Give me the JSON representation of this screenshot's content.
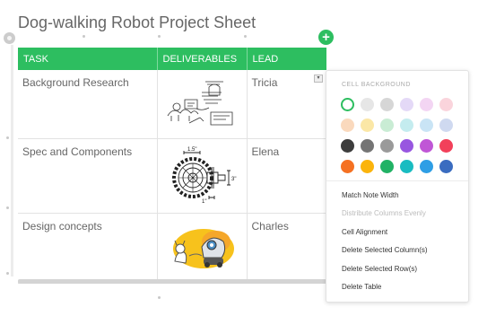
{
  "note": {
    "title": "Dog-walking Robot Project Sheet"
  },
  "table": {
    "columns": [
      "TASK",
      "DELIVERABLES",
      "LEAD"
    ],
    "rows": [
      {
        "task": "Background Research",
        "deliverable_icon": "robot-sketch-icon",
        "lead": "Tricia"
      },
      {
        "task": "Spec and Components",
        "deliverable_icon": "gear-diagram-icon",
        "lead": "Elena"
      },
      {
        "task": "Design concepts",
        "deliverable_icon": "robot-concept-icon",
        "lead": "Charles"
      }
    ],
    "header_color": "#2dbe60"
  },
  "diagram_labels": {
    "dim_top": "1.5\"",
    "dim_right": "3\"",
    "dim_bottom": "1\""
  },
  "popover": {
    "section_label": "CELL BACKGROUND",
    "swatch_colors": [
      "#ffffff",
      "#e6e6e6",
      "#d6d6d6",
      "#e4d9f7",
      "#f3d5f3",
      "#fad4dc",
      "#fad9bd",
      "#fbe7a6",
      "#c9ecd4",
      "#c4ecef",
      "#c9e4f5",
      "#cfd9f0",
      "#3d3d3d",
      "#757575",
      "#9a9a9a",
      "#9856e0",
      "#c056d6",
      "#f2405a",
      "#f57122",
      "#fbb40c",
      "#21b265",
      "#19bcc1",
      "#2e9ee5",
      "#3a6cc0"
    ],
    "selected_swatch": "#ffffff",
    "menu_items": [
      {
        "label": "Match Note Width",
        "enabled": true
      },
      {
        "label": "Distribute Columns Evenly",
        "enabled": false
      },
      {
        "label": "Cell Alignment",
        "enabled": true
      },
      {
        "label": "Delete Selected Column(s)",
        "enabled": true
      },
      {
        "label": "Delete Selected Row(s)",
        "enabled": true
      },
      {
        "label": "Delete Table",
        "enabled": true
      }
    ]
  },
  "icons": {
    "add": "+",
    "cell_menu": "▾"
  }
}
